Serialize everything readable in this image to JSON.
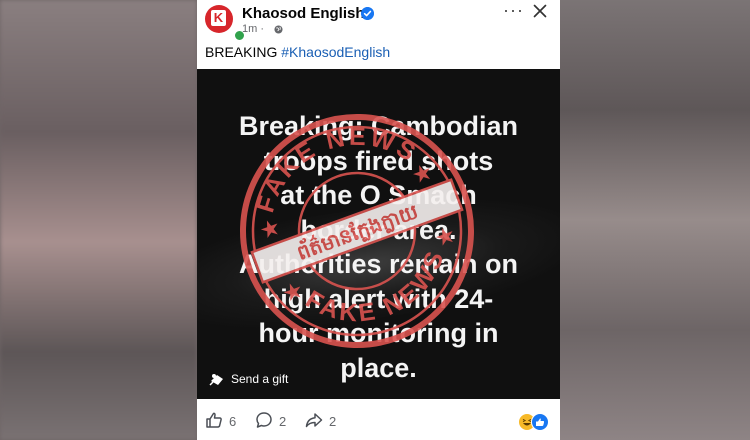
{
  "post": {
    "page_name": "Khaosod English",
    "logo_letter": "K",
    "time": "1m ·",
    "text_prefix": "BREAKING",
    "hashtag": "#KhaosodEnglish"
  },
  "media": {
    "overlay_text": "Breaking: Cambodian\ntroops fired shots\nat the O Smach\nborder area.\nAuthorities remain on\nhigh alert with 24-\nhour monitoring in\nplace.",
    "stamp_top_text": "FAKE NEWS",
    "stamp_bottom_text": "FAKE NEWS",
    "stamp_center_text": "ព័ត៌មានក្លែងក្លាយ",
    "stamp_color": "#d9534f",
    "send_gift_label": "Send a gift"
  },
  "actions": {
    "likes": "6",
    "comments": "2",
    "shares": "2"
  },
  "colors": {
    "brand_red": "#d7262b",
    "verified_blue": "#1877f2",
    "link_blue": "#1a5fb4"
  },
  "icons": [
    "more-icon",
    "close-icon",
    "verified-icon",
    "globe-icon",
    "gift-icon",
    "like-icon",
    "comment-icon",
    "share-icon",
    "haha-reaction-icon",
    "like-reaction-icon"
  ]
}
